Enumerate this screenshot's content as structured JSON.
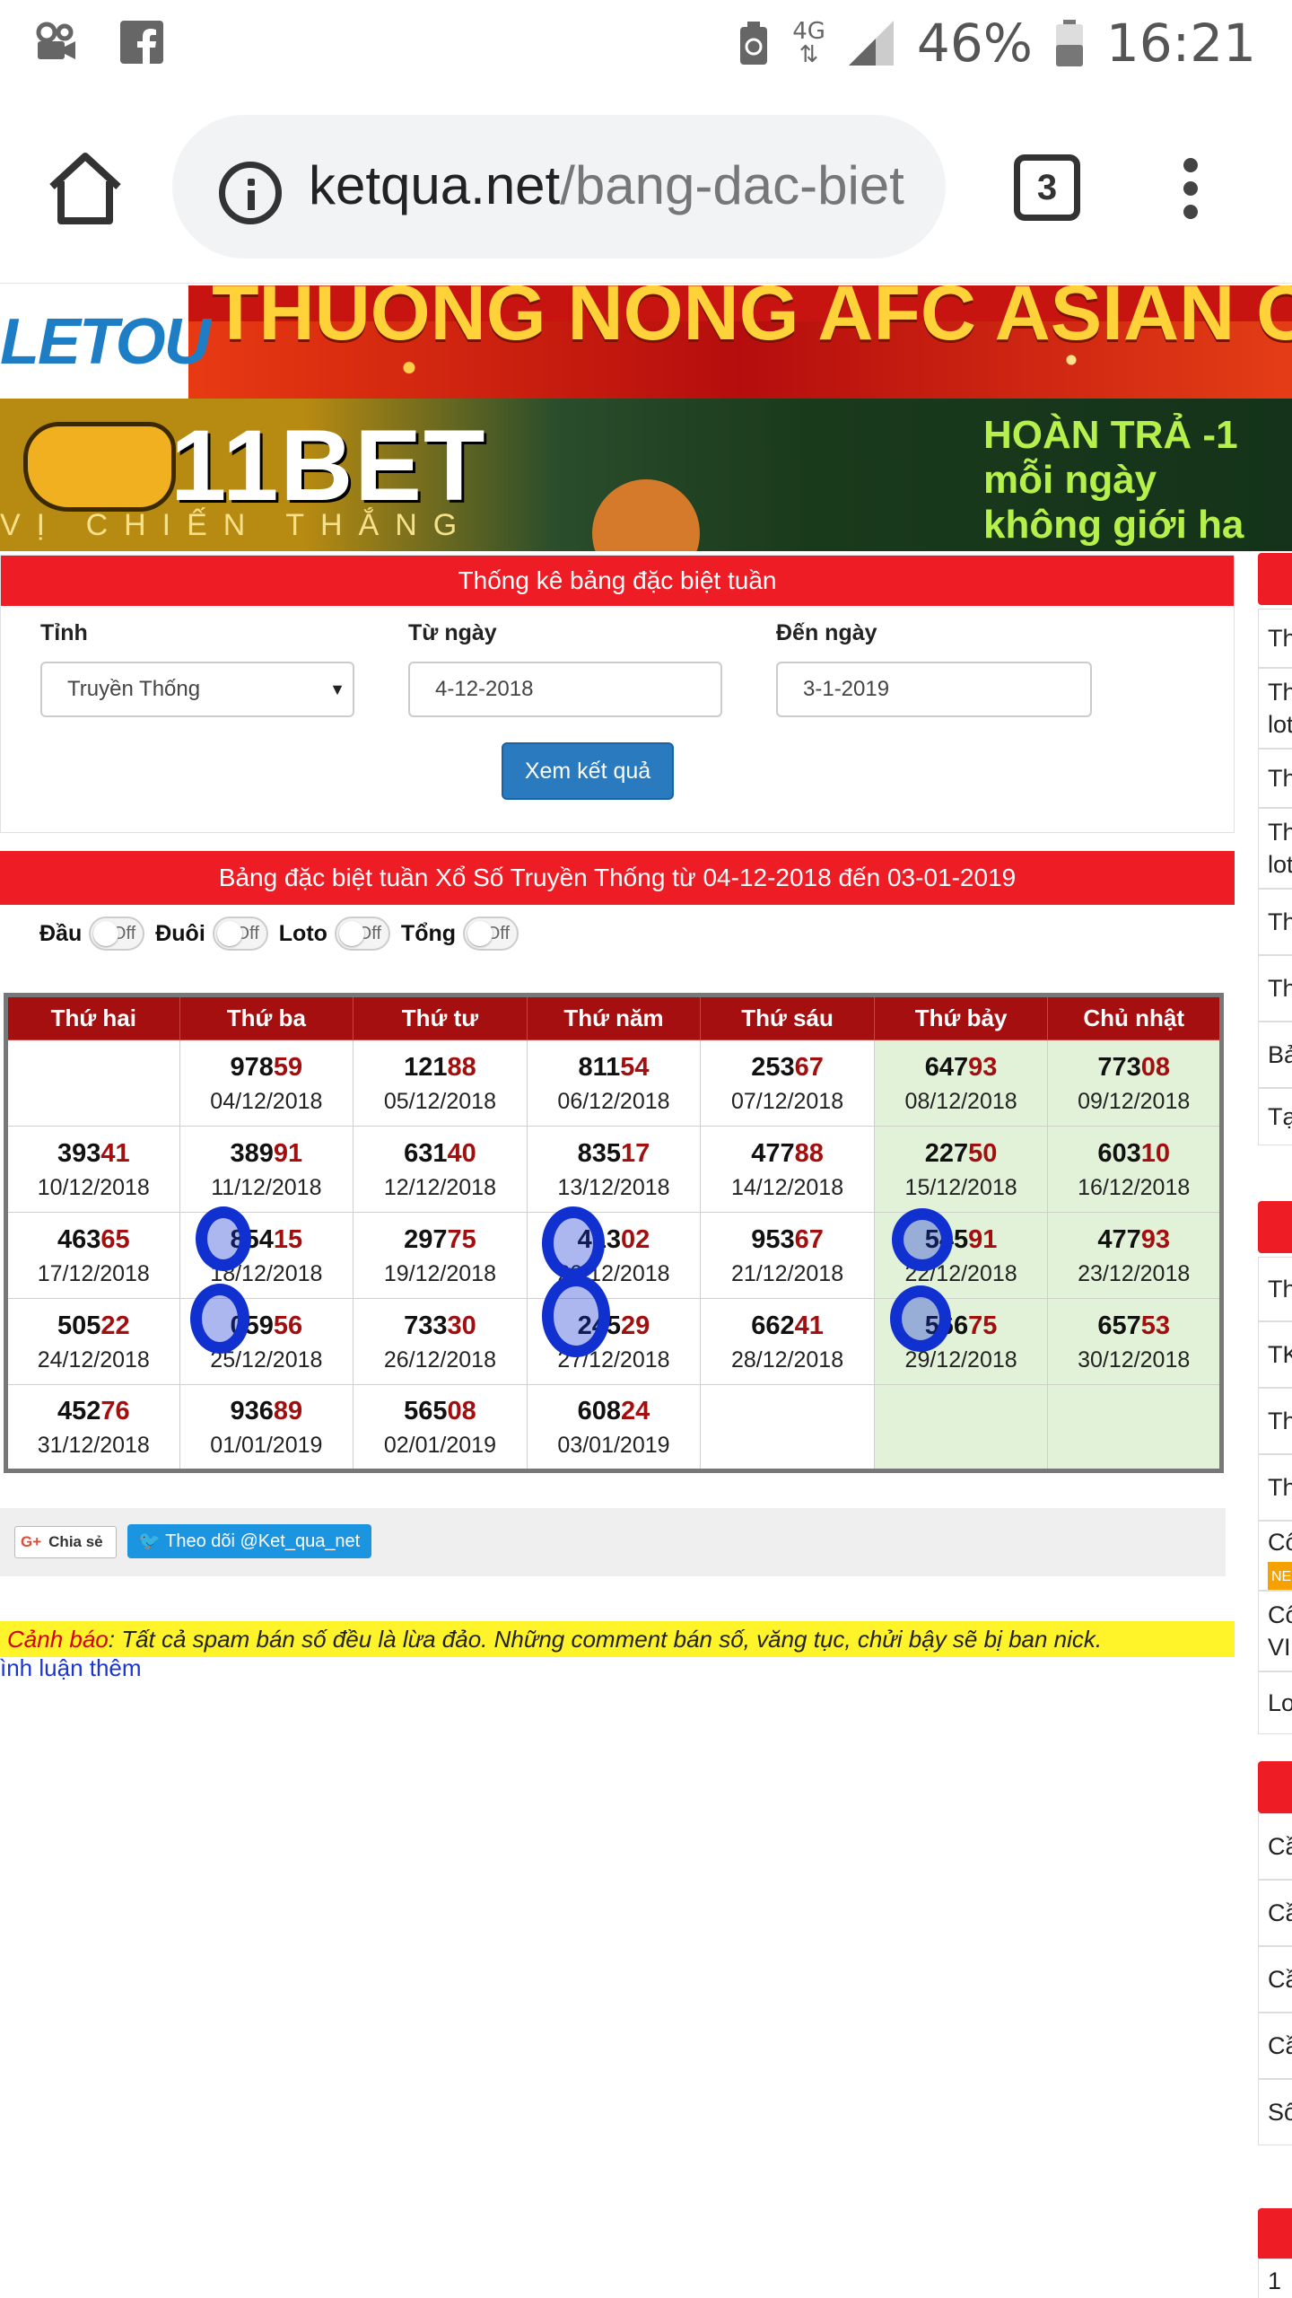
{
  "status": {
    "network": "4G",
    "battery_percent": "46%",
    "time": "16:21"
  },
  "browser": {
    "url_domain": "ketqua.net",
    "url_path": "/bang-dac-biet",
    "tab_count": "3"
  },
  "banners": {
    "top_logo": "LETOU",
    "top_text": "THUONG NONG AFC ASIAN CU",
    "brand": "11BET",
    "tagline": "VỊ CHIẾN THẮNG",
    "promo_lines": [
      "HOÀN TRẢ  -1",
      "mỗi ngày",
      "không giới ha"
    ]
  },
  "form": {
    "title": "Thống kê bảng đặc biệt tuần",
    "province_label": "Tỉnh",
    "province_value": "Truyền Thống",
    "from_label": "Từ ngày",
    "from_value": "4-12-2018",
    "to_label": "Đến ngày",
    "to_value": "3-1-2019",
    "submit": "Xem kết quả"
  },
  "results": {
    "title": "Bảng đặc biệt tuần Xổ Số Truyền Thống từ 04-12-2018 đến 03-01-2019",
    "toggles": [
      {
        "label": "Đầu",
        "state": "Off"
      },
      {
        "label": "Đuôi",
        "state": "Off"
      },
      {
        "label": "Loto",
        "state": "Off"
      },
      {
        "label": "Tổng",
        "state": "Off"
      }
    ],
    "headers": [
      "Thứ hai",
      "Thứ ba",
      "Thứ tư",
      "Thứ năm",
      "Thứ sáu",
      "Thứ bảy",
      "Chủ nhật"
    ],
    "rows": [
      [
        {
          "head": "",
          "tail": "",
          "date": ""
        },
        {
          "head": "978",
          "tail": "59",
          "date": "04/12/2018"
        },
        {
          "head": "121",
          "tail": "88",
          "date": "05/12/2018"
        },
        {
          "head": "811",
          "tail": "54",
          "date": "06/12/2018"
        },
        {
          "head": "253",
          "tail": "67",
          "date": "07/12/2018"
        },
        {
          "head": "647",
          "tail": "93",
          "date": "08/12/2018"
        },
        {
          "head": "773",
          "tail": "08",
          "date": "09/12/2018"
        }
      ],
      [
        {
          "head": "393",
          "tail": "41",
          "date": "10/12/2018"
        },
        {
          "head": "389",
          "tail": "91",
          "date": "11/12/2018"
        },
        {
          "head": "631",
          "tail": "40",
          "date": "12/12/2018"
        },
        {
          "head": "835",
          "tail": "17",
          "date": "13/12/2018"
        },
        {
          "head": "477",
          "tail": "88",
          "date": "14/12/2018"
        },
        {
          "head": "227",
          "tail": "50",
          "date": "15/12/2018"
        },
        {
          "head": "603",
          "tail": "10",
          "date": "16/12/2018"
        }
      ],
      [
        {
          "head": "463",
          "tail": "65",
          "date": "17/12/2018"
        },
        {
          "head": "854",
          "tail": "15",
          "date": "18/12/2018"
        },
        {
          "head": "297",
          "tail": "75",
          "date": "19/12/2018"
        },
        {
          "head": "413",
          "tail": "02",
          "date": "20/12/2018"
        },
        {
          "head": "953",
          "tail": "67",
          "date": "21/12/2018"
        },
        {
          "head": "545",
          "tail": "91",
          "date": "22/12/2018"
        },
        {
          "head": "477",
          "tail": "93",
          "date": "23/12/2018"
        }
      ],
      [
        {
          "head": "505",
          "tail": "22",
          "date": "24/12/2018"
        },
        {
          "head": "059",
          "tail": "56",
          "date": "25/12/2018"
        },
        {
          "head": "733",
          "tail": "30",
          "date": "26/12/2018"
        },
        {
          "head": "245",
          "tail": "29",
          "date": "27/12/2018"
        },
        {
          "head": "662",
          "tail": "41",
          "date": "28/12/2018"
        },
        {
          "head": "566",
          "tail": "75",
          "date": "29/12/2018"
        },
        {
          "head": "657",
          "tail": "53",
          "date": "30/12/2018"
        }
      ],
      [
        {
          "head": "452",
          "tail": "76",
          "date": "31/12/2018"
        },
        {
          "head": "936",
          "tail": "89",
          "date": "01/01/2019"
        },
        {
          "head": "565",
          "tail": "08",
          "date": "02/01/2019"
        },
        {
          "head": "608",
          "tail": "24",
          "date": "03/01/2019"
        },
        {
          "head": "",
          "tail": "",
          "date": ""
        },
        {
          "head": "",
          "tail": "",
          "date": ""
        },
        {
          "head": "",
          "tail": "",
          "date": ""
        }
      ]
    ]
  },
  "share": {
    "gplus_label": "Chia sẻ",
    "twitter_label": "Theo dõi @Ket_qua_net"
  },
  "warning": {
    "label": "Cảnh báo",
    "text": ": Tất cả spam bán số đều là lừa đảo. Những comment bán số, văng tục, chửi bậy sẽ bị ban nick."
  },
  "more_comments": "ình luận thêm",
  "sidebar": {
    "items": [
      "Th",
      "Th lot",
      "Th",
      "Th lot",
      "Th",
      "Th",
      "Bả",
      "Tạ",
      "Th",
      "TK",
      "Th",
      "Th",
      "Cô",
      "Cô VI",
      "Lo",
      "Cầ",
      "Cầ",
      "Cầ",
      "Cầ",
      "Sô",
      "1"
    ],
    "badge": "NE"
  },
  "colors": {
    "accent_red": "#ee1c25",
    "table_header": "#a50f0f",
    "weekend_cell": "#e1f2d9",
    "submit_blue": "#2a7ac0",
    "warning_yellow": "#fff32a",
    "annotation_marker": "#1030d0"
  }
}
